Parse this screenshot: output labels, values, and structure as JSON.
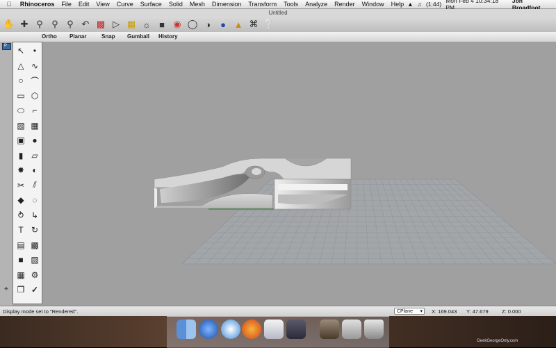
{
  "menubar": {
    "apple": "",
    "items": [
      "Rhinoceros",
      "File",
      "Edit",
      "View",
      "Curve",
      "Surface",
      "Solid",
      "Mesh",
      "Dimension",
      "Transform",
      "Tools",
      "Analyze",
      "Render",
      "Window",
      "Help"
    ],
    "battery": "(1:44)",
    "clock": "Mon Feb 4  10:34:18 PM",
    "user": "Jon Broadfoot"
  },
  "window": {
    "title": "Untitled"
  },
  "toolbar": {
    "icons": [
      "pan-icon",
      "rotate-view-icon",
      "zoom-icon",
      "zoom-window-icon",
      "zoom-extents-icon",
      "undo-view-icon",
      "car-icon",
      "select-icon",
      "layers-icon",
      "light-icon",
      "lock-icon",
      "color-wheel-icon",
      "sphere-wireframe-icon",
      "sphere-shaded-icon",
      "sphere-render-icon",
      "render-icon",
      "command-icon",
      "help-icon"
    ]
  },
  "tabs": {
    "ortho": "Ortho",
    "planar": "Planar",
    "snap": "Snap",
    "gumball": "Gumball",
    "history": "History"
  },
  "viewport": {
    "label": "P"
  },
  "palette": {
    "icons": [
      "select-arrow",
      "point",
      "polyline",
      "curve",
      "circle",
      "arc",
      "rectangle",
      "polygon",
      "ellipse",
      "fillet",
      "surface",
      "network",
      "solid-box",
      "solid-sphere",
      "extrude",
      "patch",
      "explode",
      "boolean",
      "trim",
      "split",
      "color-solid",
      "smooth",
      "rebuild",
      "offset",
      "text",
      "rotate",
      "group",
      "array",
      "block",
      "mesh",
      "grid",
      "render-props",
      "analyze",
      "check"
    ]
  },
  "statusbar": {
    "message": "Display mode set to \"Rendered\".",
    "cplane": "CPlane",
    "x": "X: 169.043",
    "y": "Y: 47.679",
    "z": "Z: 0.000"
  },
  "dock": {
    "watermark": "GeekGeorgeOnly.com"
  },
  "colors": {
    "viewport_bg": "#a0a0a0",
    "grid": "#8f959c",
    "model": "#e6e6e6"
  }
}
